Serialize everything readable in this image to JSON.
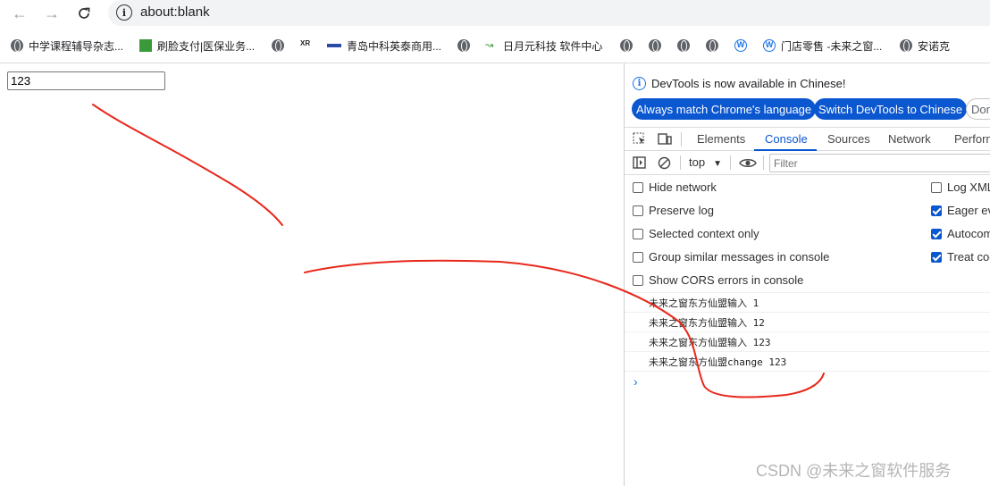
{
  "browser": {
    "url": "about:blank",
    "bookmarks": [
      {
        "label": "中学课程辅导杂志...",
        "icon": "globe-icon"
      },
      {
        "label": "刷脸支付|医保业务...",
        "icon": "green-logo-icon"
      },
      {
        "label": "",
        "icon": "globe-icon"
      },
      {
        "label": "",
        "icon": "xr-logo-icon"
      },
      {
        "label": "青岛中科英泰商用...",
        "icon": "wintec-logo-icon"
      },
      {
        "label": "",
        "icon": "globe-icon"
      },
      {
        "label": "日月元科技 软件中心",
        "icon": "arrow-logo-icon"
      },
      {
        "label": "",
        "icon": "globe-icon"
      },
      {
        "label": "",
        "icon": "globe-icon"
      },
      {
        "label": "",
        "icon": "globe-icon"
      },
      {
        "label": "",
        "icon": "globe-icon"
      },
      {
        "label": "",
        "icon": "wordpress-icon"
      },
      {
        "label": "门店零售 -未来之窗...",
        "icon": "wordpress-icon"
      },
      {
        "label": "安诺克",
        "icon": "globe-icon"
      }
    ]
  },
  "page": {
    "input_value": "123"
  },
  "devtools": {
    "info_text": "DevTools is now available in Chinese!",
    "btn_match": "Always match Chrome's language",
    "btn_switch": "Switch DevTools to Chinese",
    "btn_dont": "Don",
    "tabs": [
      "Elements",
      "Console",
      "Sources",
      "Network",
      "Perform"
    ],
    "active_tab": "Console",
    "context": "top",
    "filter_placeholder": "Filter",
    "options_left": [
      {
        "label": "Hide network",
        "checked": false
      },
      {
        "label": "Preserve log",
        "checked": false
      },
      {
        "label": "Selected context only",
        "checked": false
      },
      {
        "label": "Group similar messages in console",
        "checked": false
      },
      {
        "label": "Show CORS errors in console",
        "checked": false
      }
    ],
    "options_right": [
      {
        "label": "Log XML",
        "checked": false
      },
      {
        "label": "Eager ev",
        "checked": true
      },
      {
        "label": "Autocom",
        "checked": true
      },
      {
        "label": "Treat coc",
        "checked": true
      }
    ],
    "messages": [
      "未来之窗东方仙盟输入 1",
      "未来之窗东方仙盟输入 12",
      "未来之窗东方仙盟输入 123",
      "未来之窗东方仙盟change 123"
    ],
    "prompt": "›"
  },
  "watermark": "CSDN @未来之窗软件服务",
  "colors": {
    "accent": "#0b57d0",
    "scribble": "#e8281c"
  }
}
